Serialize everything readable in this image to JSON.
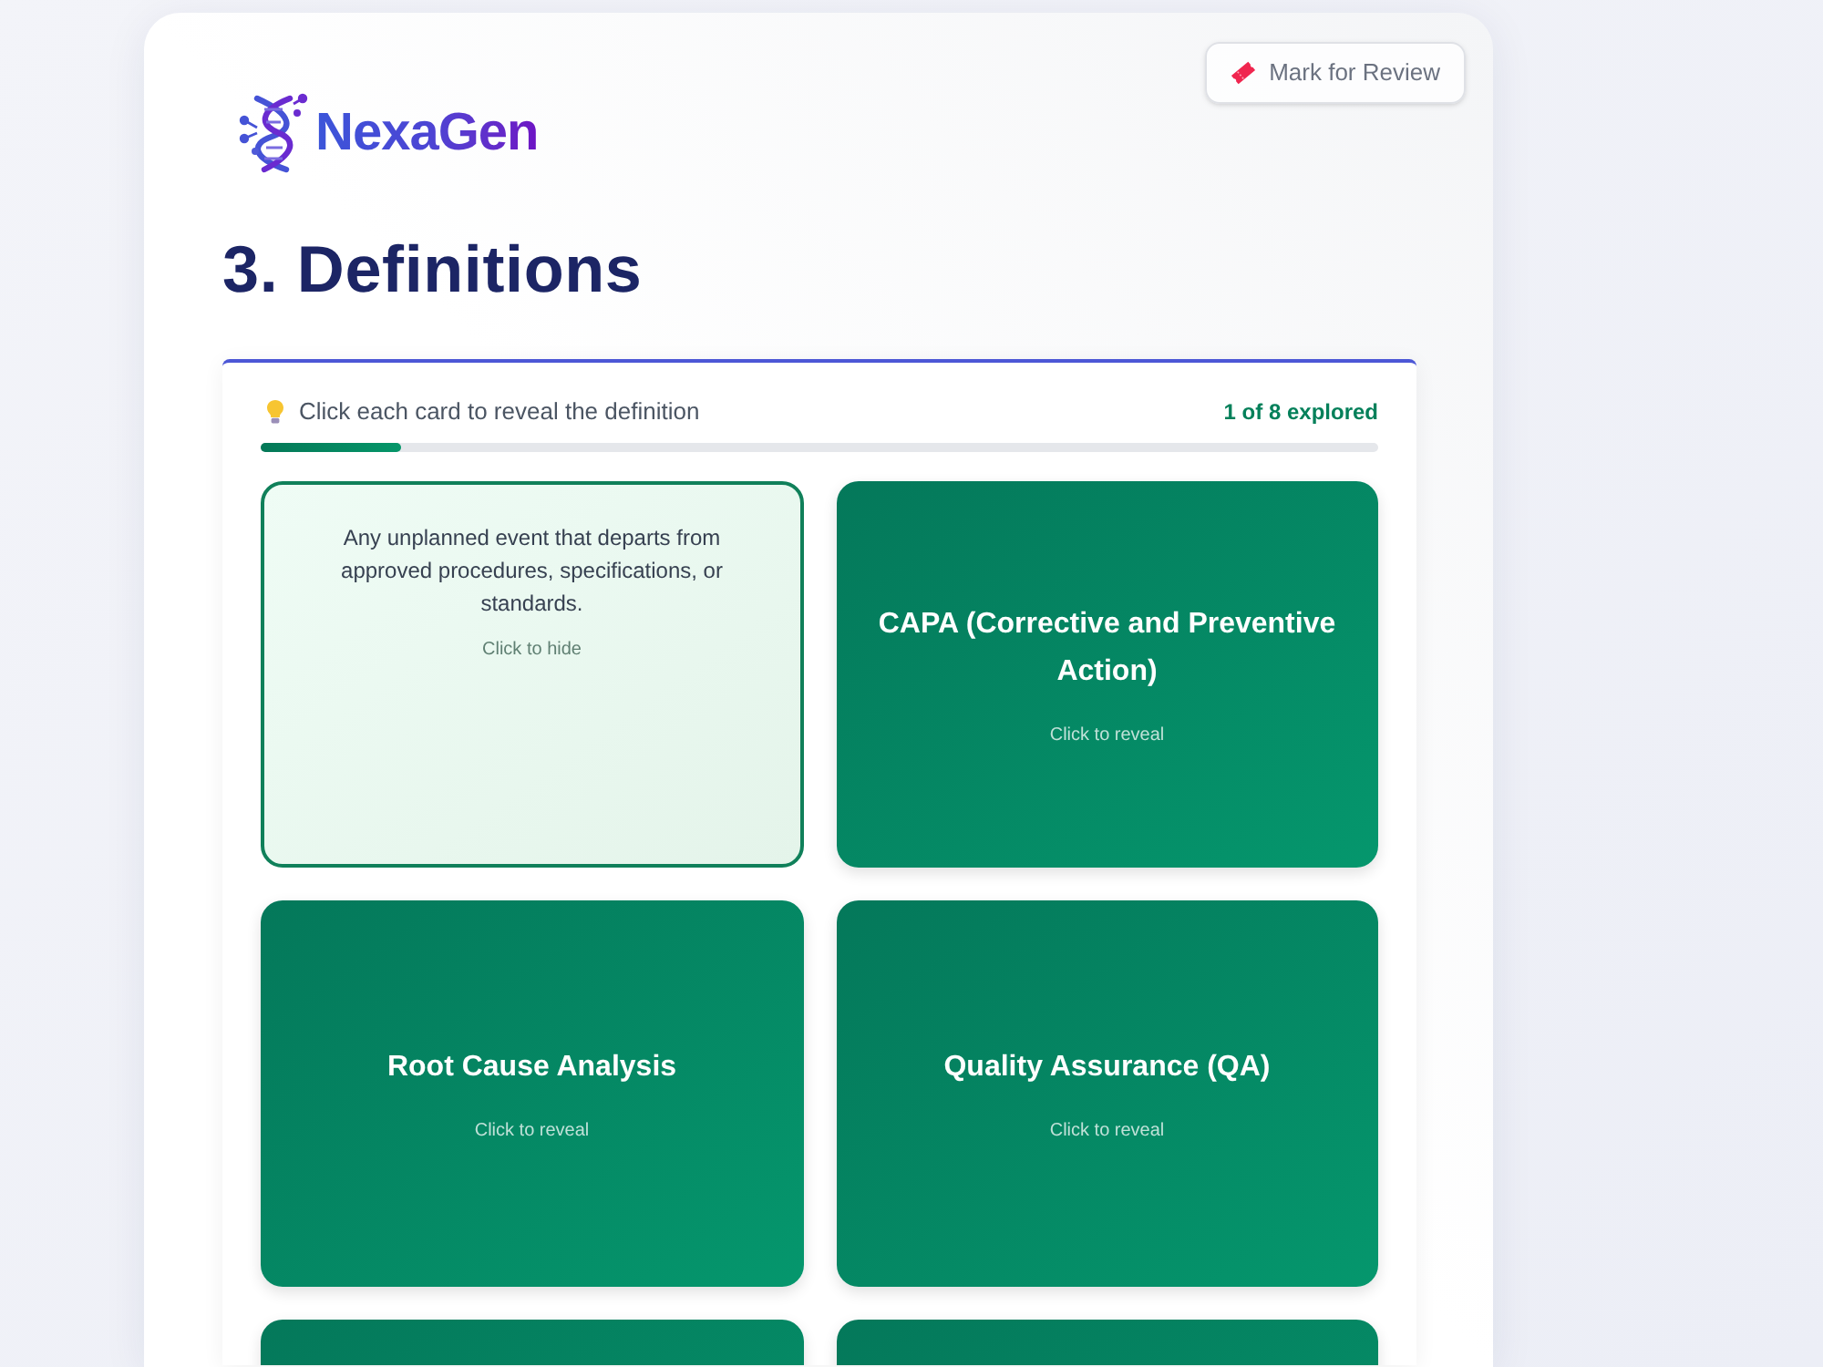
{
  "review_button": {
    "label": "Mark for Review"
  },
  "brand": {
    "name": "NexaGen"
  },
  "heading": "3. Definitions",
  "progress": {
    "hint": "Click each card to reveal the definition",
    "count": "1 of 8 explored",
    "level": 0.125
  },
  "cards": [
    {
      "revealed": true,
      "definition": "Any unplanned event that departs from approved procedures, specifications, or standards.",
      "hint": "Click to hide"
    },
    {
      "revealed": false,
      "term": "CAPA (Corrective and Preventive Action)",
      "hint": "Click to reveal"
    },
    {
      "revealed": false,
      "term": "Root Cause Analysis",
      "hint": "Click to reveal"
    },
    {
      "revealed": false,
      "term": "Quality Assurance (QA)",
      "hint": "Click to reveal"
    },
    {
      "revealed": false
    },
    {
      "revealed": false
    }
  ]
}
